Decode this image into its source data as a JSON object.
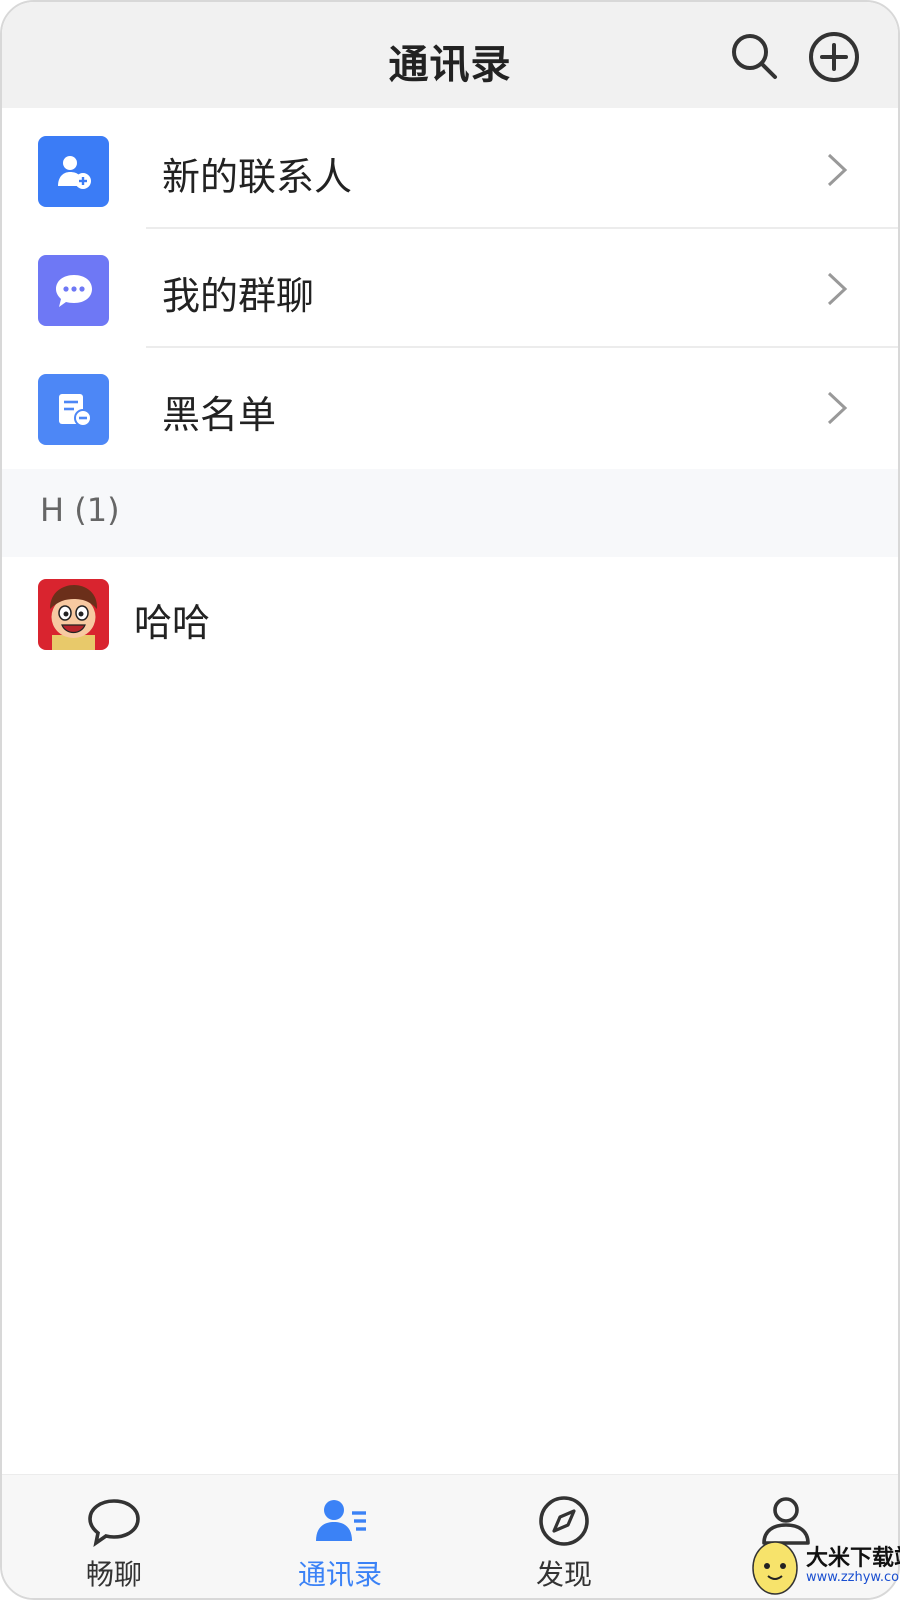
{
  "header": {
    "title": "通讯录",
    "search_icon": "search-icon",
    "add_icon": "plus-circle-icon"
  },
  "menu": [
    {
      "label": "新的联系人",
      "icon": "add-user-icon",
      "icon_color": "#3b7cf6"
    },
    {
      "label": "我的群聊",
      "icon": "chat-bubble-icon",
      "icon_color": "#6e78f5"
    },
    {
      "label": "黑名单",
      "icon": "block-list-icon",
      "icon_color": "#4d87f6"
    }
  ],
  "section": {
    "label": "H (1)"
  },
  "contacts": [
    {
      "name": "哈哈",
      "avatar": "cartoon-avatar"
    }
  ],
  "tabs": [
    {
      "label": "畅聊",
      "icon": "chat-icon",
      "active": false
    },
    {
      "label": "通讯录",
      "icon": "contacts-icon",
      "active": true
    },
    {
      "label": "发现",
      "icon": "compass-icon",
      "active": false
    },
    {
      "label": "",
      "icon": "profile-icon",
      "active": false
    }
  ],
  "watermark": {
    "text": "大米下载站",
    "url": "www.zzhyw.com"
  },
  "colors": {
    "accent": "#3b82f6",
    "header_bg": "#f1f1f1",
    "section_bg": "#f7f8fa"
  }
}
